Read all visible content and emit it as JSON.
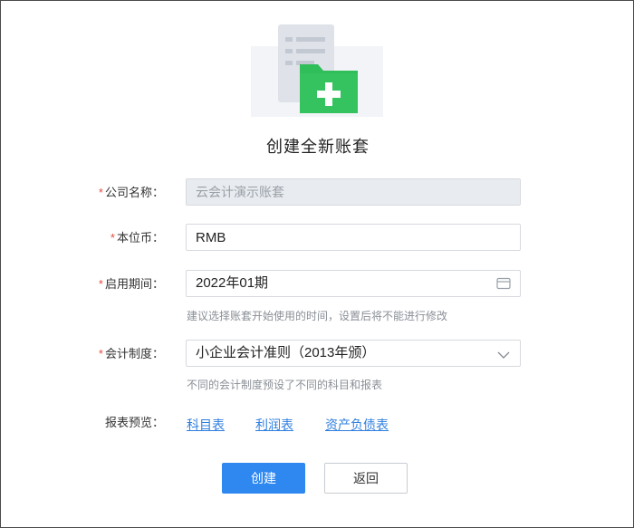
{
  "page": {
    "title": "创建全新账套"
  },
  "form": {
    "company": {
      "required_mark": "*",
      "label": "公司名称：",
      "value": "云会计演示账套"
    },
    "currency": {
      "required_mark": "*",
      "label": "本位币：",
      "value": "RMB"
    },
    "period": {
      "required_mark": "*",
      "label": "启用期间：",
      "value": "2022年01期",
      "hint": "建议选择账套开始使用的时间，设置后将不能进行修改"
    },
    "system": {
      "required_mark": "*",
      "label": "会计制度：",
      "value": "小企业会计准则（2013年颁）",
      "hint": "不同的会计制度预设了不同的科目和报表"
    },
    "preview": {
      "label": "报表预览：",
      "links": [
        "科目表",
        "利润表",
        "资产负债表"
      ]
    }
  },
  "actions": {
    "create": "创建",
    "back": "返回"
  },
  "colors": {
    "primary": "#2f87f0",
    "link": "#2f7fe0",
    "required": "#e64b3c",
    "folder_green": "#2fbe5a"
  }
}
